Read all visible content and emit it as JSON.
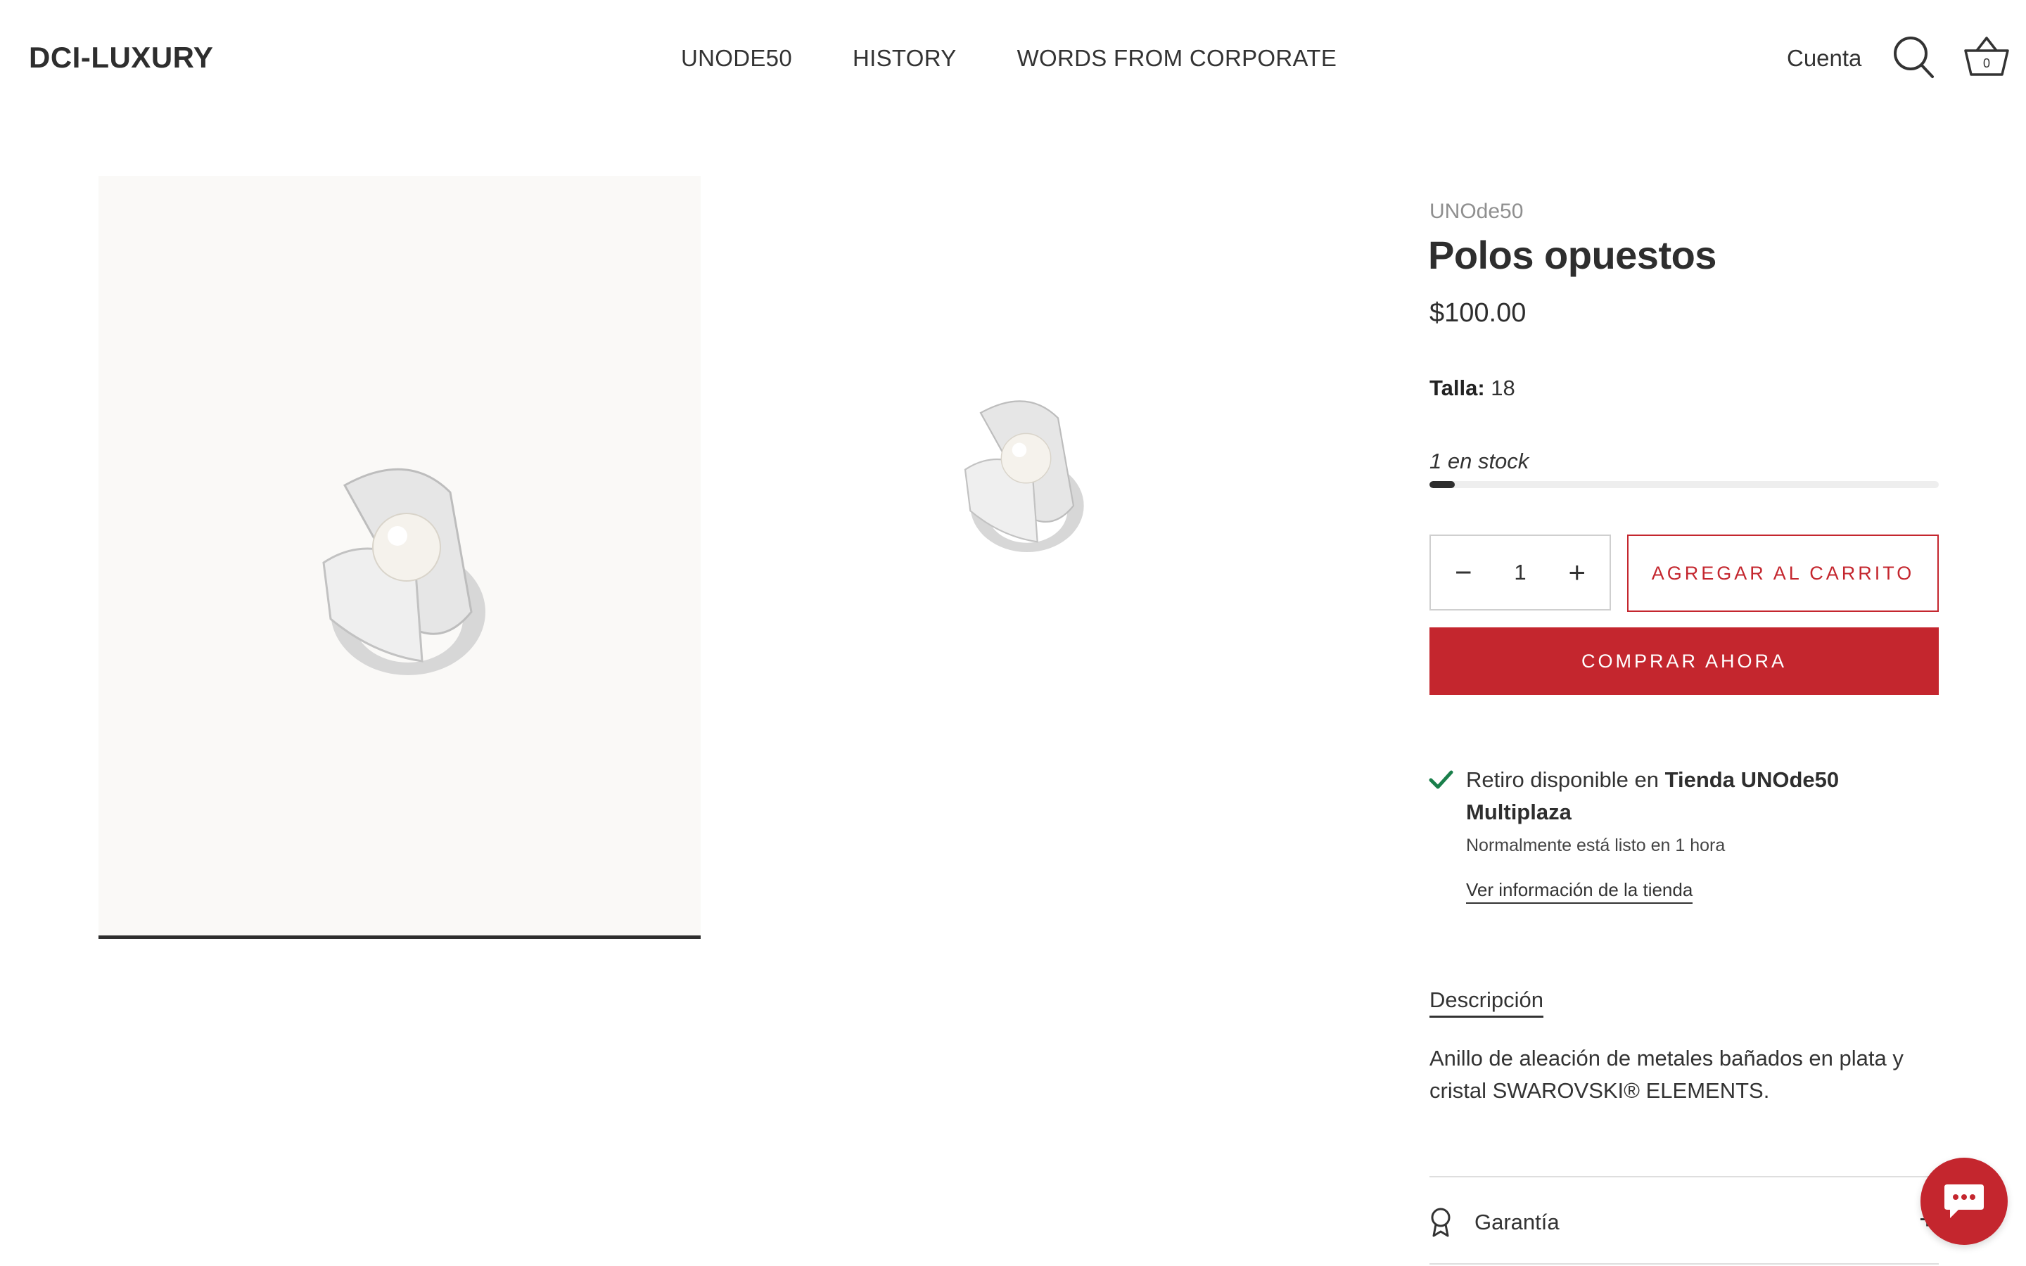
{
  "header": {
    "logo": "DCI-LUXURY",
    "nav": [
      "UNODE50",
      "HISTORY",
      "WORDS FROM CORPORATE"
    ],
    "account_label": "Cuenta",
    "cart_count": "0"
  },
  "gallery": {
    "active_index": 0
  },
  "product": {
    "vendor": "UNOde50",
    "title": "Polos opuestos",
    "price": "$100.00",
    "size_label": "Talla:",
    "size_value": "18",
    "stock_text": "1 en stock",
    "stock_fraction": 0.05,
    "quantity": "1",
    "add_to_cart_label": "AGREGAR AL CARRITO",
    "buy_now_label": "COMPRAR AHORA"
  },
  "pickup": {
    "available_prefix": "Retiro disponible en",
    "store_name": "Tienda UNOde50 Multiplaza",
    "note": "Normalmente está listo en 1 hora",
    "link": "Ver información de la tienda"
  },
  "description": {
    "tab_label": "Descripción",
    "body": "Anillo de aleación de metales bañados en plata y cristal SWAROVSKI® ELEMENTS."
  },
  "accordion": {
    "warranty_label": "Garantía",
    "expand_symbol": "+"
  },
  "colors": {
    "accent": "#c4262e",
    "check": "#1a7f4b",
    "text": "#333333"
  },
  "icons": [
    "search-icon",
    "cart-icon",
    "check-icon",
    "award-icon",
    "chat-icon"
  ]
}
